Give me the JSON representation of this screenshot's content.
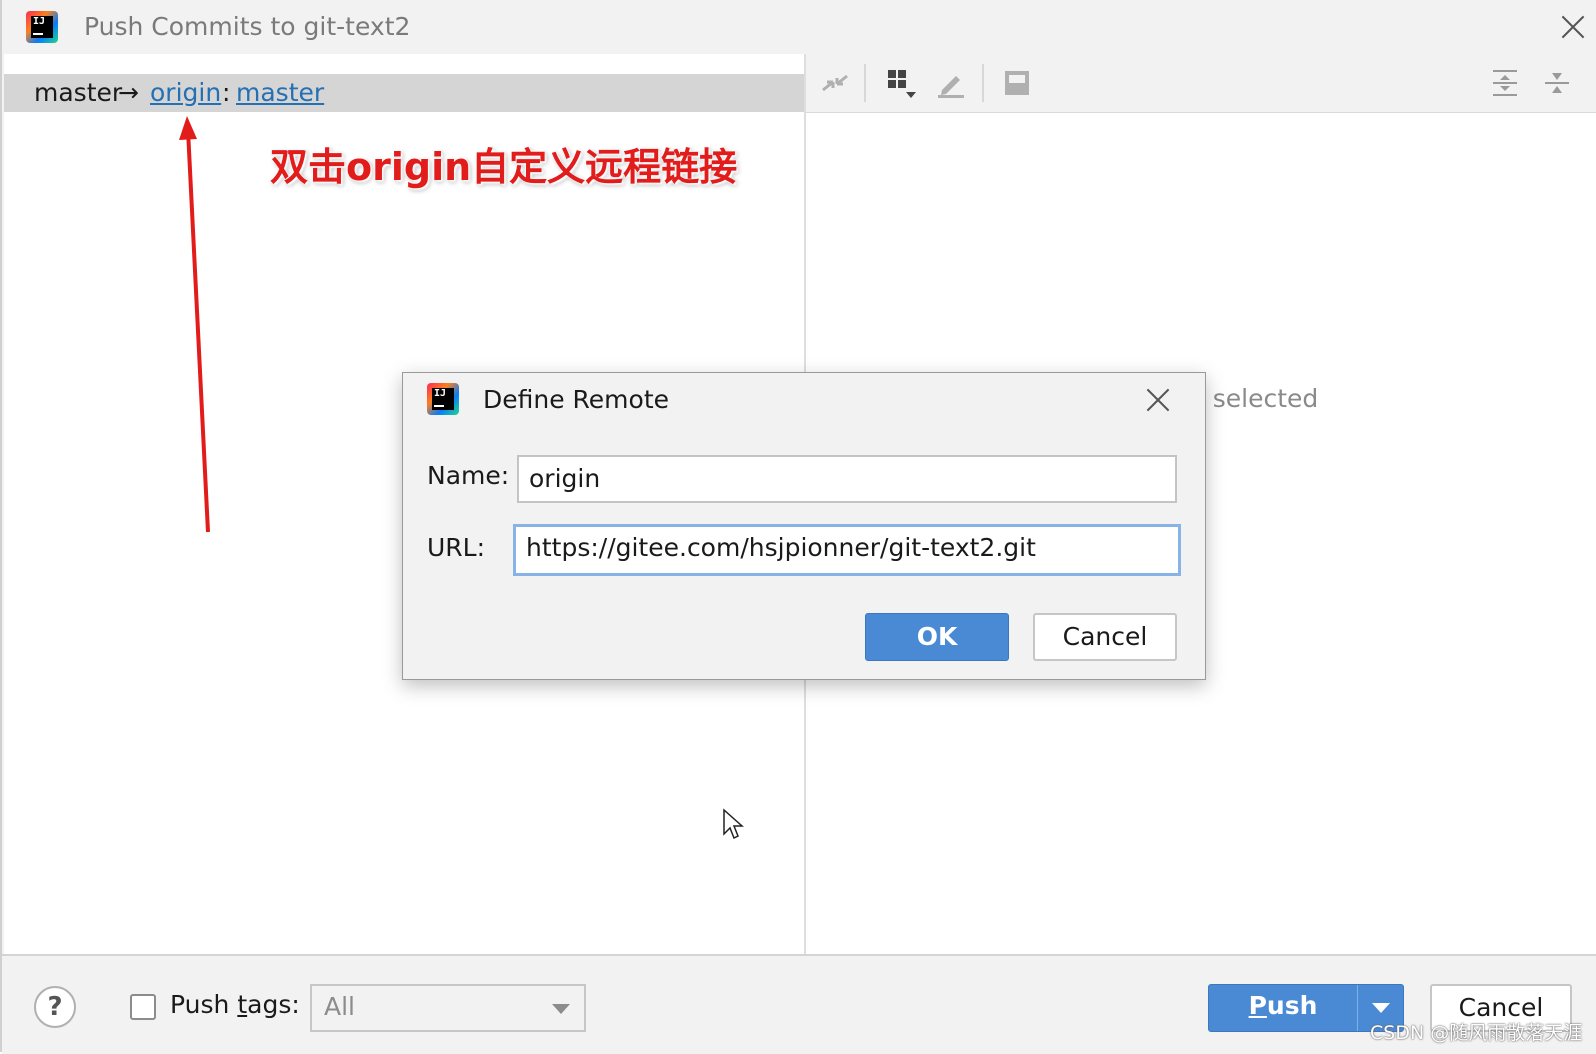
{
  "window": {
    "title": "Push Commits to git-text2"
  },
  "branch_row": {
    "source": "master",
    "arrow": "→",
    "remote": "origin",
    "separator": ":",
    "target": "master"
  },
  "commit_details": {
    "placeholder": "ts selected"
  },
  "annotation": {
    "text": "双击origin自定义远程链接",
    "color": "#e21b1b"
  },
  "toolbar": {
    "icons": [
      "merge-arrows-icon",
      "group-by-icon",
      "edit-icon",
      "split-view-icon",
      "expand-all-icon",
      "collapse-all-icon"
    ]
  },
  "dialog": {
    "title": "Define Remote",
    "name_label": "Name:",
    "name_value": "origin",
    "url_label": "URL:",
    "url_value": "https://gitee.com/hsjpionner/git-text2.git",
    "ok_label": "OK",
    "cancel_label": "Cancel"
  },
  "bottom": {
    "help_label": "?",
    "push_tags_label_pre": "Push ",
    "push_tags_label_mnemonic": "t",
    "push_tags_label_post": "ags:",
    "push_tags_checked": false,
    "tags_select_value": "All",
    "push_label_mnemonic": "P",
    "push_label_rest": "ush",
    "cancel_label": "Cancel"
  },
  "watermark": "CSDN @随风雨散落天涯",
  "colors": {
    "accent": "#4a8ad4",
    "link": "#2470b3",
    "focus_ring": "#87b3e6"
  }
}
